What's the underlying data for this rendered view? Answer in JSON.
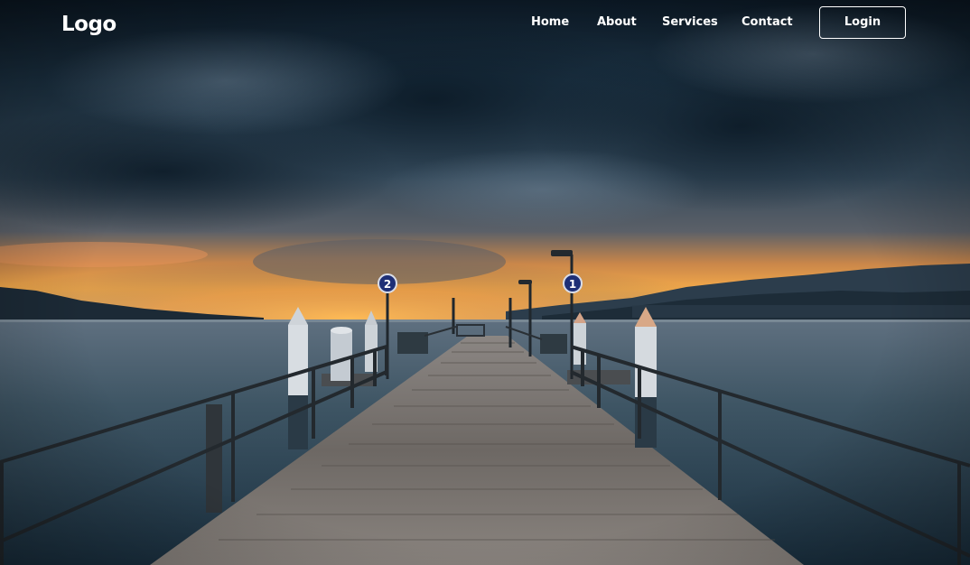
{
  "header": {
    "logo_text": "Logo"
  },
  "nav": {
    "items": [
      {
        "label": "Home"
      },
      {
        "label": "About"
      },
      {
        "label": "Services"
      },
      {
        "label": "Contact"
      }
    ],
    "login_label": "Login"
  },
  "hero": {
    "signs": {
      "left_number": "2",
      "right_number": "1"
    }
  },
  "colors": {
    "nav_text": "#ffffff",
    "sky_dark": "#0f1f2e",
    "horizon_glow": "#f0a64a",
    "water": "#3c5566",
    "pier_wood": "#7d7873"
  }
}
